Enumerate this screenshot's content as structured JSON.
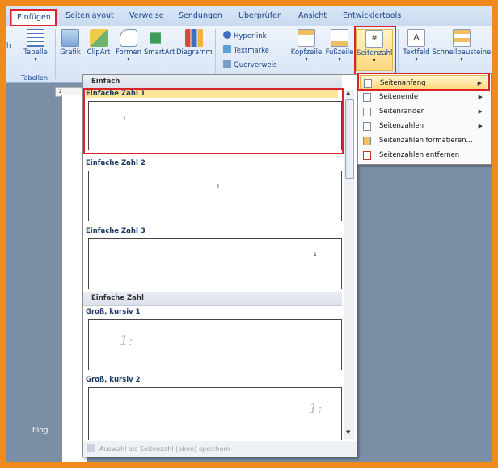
{
  "tabs": [
    "Einfügen",
    "Seitenlayout",
    "Verweise",
    "Sendungen",
    "Überprüfen",
    "Ansicht",
    "Entwicklertools"
  ],
  "ribbon": {
    "left_partial": "h",
    "tabelle": "Tabelle",
    "tabellen_group": "Tabellen",
    "grafik": "Grafik",
    "clipart": "ClipArt",
    "formen": "Formen",
    "smartart": "SmartArt",
    "diagramm": "Diagramm",
    "hyperlink": "Hyperlink",
    "textmarke": "Textmarke",
    "querverweis": "Querverweis",
    "kopfzeile": "Kopfzeile",
    "fusszeile": "Fußzeile",
    "seitenzahl": "Seitenzahl",
    "textfeld": "Textfeld",
    "schnellbausteine": "Schnellbausteine"
  },
  "ruler_text": "· 2 ·",
  "gallery": {
    "header1": "Einfach",
    "item1": "Einfache Zahl 1",
    "item2": "Einfache Zahl 2",
    "item3": "Einfache Zahl 3",
    "header2": "Einfache Zahl",
    "item4": "Groß, kursiv 1",
    "item5": "Groß, kursiv 2",
    "small_num": "1",
    "big_num": "1:",
    "footer": "Auswahl als Seitenzahl (oben) speichern"
  },
  "menu": {
    "items": [
      "Seitenanfang",
      "Seitenende",
      "Seitenränder",
      "Seitenzahlen",
      "Seitenzahlen formatieren...",
      "Seitenzahlen entfernen"
    ]
  },
  "watermark": "blog",
  "colors": {
    "frame": "#f08a1c",
    "highlight_box": "#d9232d",
    "menu_highlight": "#ffd97a"
  }
}
